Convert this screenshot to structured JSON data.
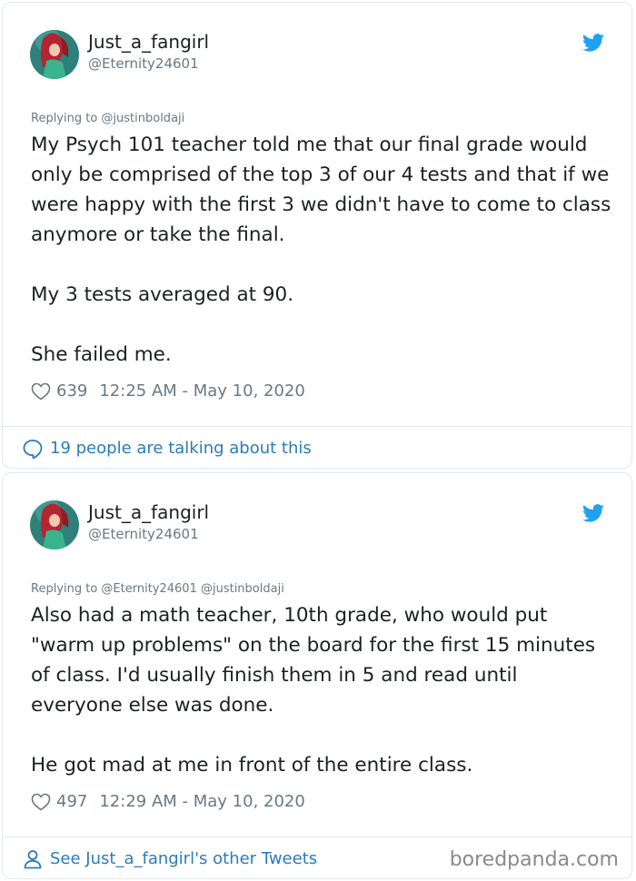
{
  "colors": {
    "link": "#2b7bb9",
    "muted": "#697882",
    "text": "#1c2022",
    "border": "#e1e8ed",
    "twitter_blue": "#1da1f2"
  },
  "tweets": [
    {
      "author_name": "Just_a_fangirl",
      "author_handle": "@Eternity24601",
      "replying_to": "Replying to @justinboldaji",
      "paragraphs": [
        "My Psych 101 teacher told me that our final grade would only be comprised of the top 3 of our 4 tests and that if we were happy with the first 3 we didn't have to come to class anymore or take the final.",
        "My 3 tests averaged at 90.",
        "She failed me."
      ],
      "likes": "639",
      "timestamp": "12:25 AM - May 10, 2020",
      "footer_link": "19 people are talking about this",
      "footer_icon": "speech-bubble-icon"
    },
    {
      "author_name": "Just_a_fangirl",
      "author_handle": "@Eternity24601",
      "replying_to": "Replying to @Eternity24601 @justinboldaji",
      "paragraphs": [
        "Also had a math teacher, 10th grade, who would put \"warm up problems\" on the board for the first 15 minutes of class. I'd usually finish them in 5 and read until everyone else was done.",
        "He got mad at me in front of the entire class."
      ],
      "likes": "497",
      "timestamp": "12:29 AM - May 10, 2020",
      "footer_link": "See Just_a_fangirl's other Tweets",
      "footer_icon": "person-icon"
    }
  ],
  "watermark": "boredpanda.com"
}
